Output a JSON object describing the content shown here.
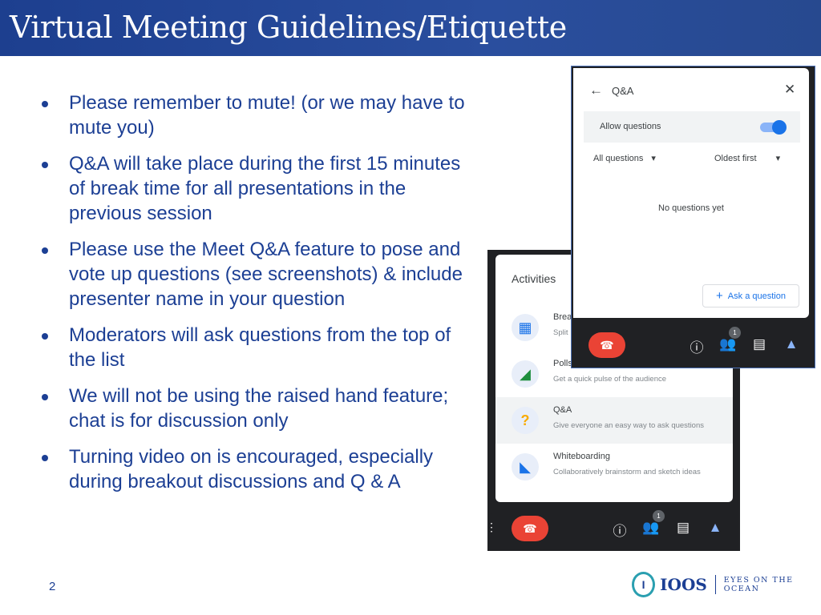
{
  "title": "Virtual Meeting Guidelines/Etiquette",
  "bullets": [
    "Please remember to mute! (or we may have to mute you)",
    "Q&A will take place during the first 15 minutes of break time for all presentations in the previous session",
    "Please use the Meet Q&A feature to pose and vote up questions (see screenshots) & include presenter name in your question",
    "Moderators will ask questions from the top of the list",
    "We will not be using the raised hand feature; chat is for discussion only",
    "Turning video on is encouraged, especially during breakout discussions and Q & A"
  ],
  "page_number": "2",
  "activities": {
    "title": "Activities",
    "items": [
      {
        "name": "Brea",
        "desc": "Split"
      },
      {
        "name": "Polls",
        "desc": "Get a quick pulse of the audience"
      },
      {
        "name": "Q&A",
        "desc": "Give everyone an easy way to ask questions"
      },
      {
        "name": "Whiteboarding",
        "desc": "Collaboratively brainstorm and sketch ideas"
      }
    ],
    "people_badge": "1"
  },
  "qa": {
    "title": "Q&A",
    "allow_label": "Allow questions",
    "allow_on": true,
    "filter": "All questions",
    "sort": "Oldest first",
    "empty": "No questions yet",
    "ask": "Ask a question",
    "people_badge": "1"
  },
  "logo": {
    "name": "IOOS",
    "tagline": "EYES ON THE OCEAN"
  },
  "colors": {
    "title_bar": "#1d3f8f",
    "text": "#1c3f94",
    "hangup": "#ea4335",
    "accent": "#1a73e8"
  }
}
